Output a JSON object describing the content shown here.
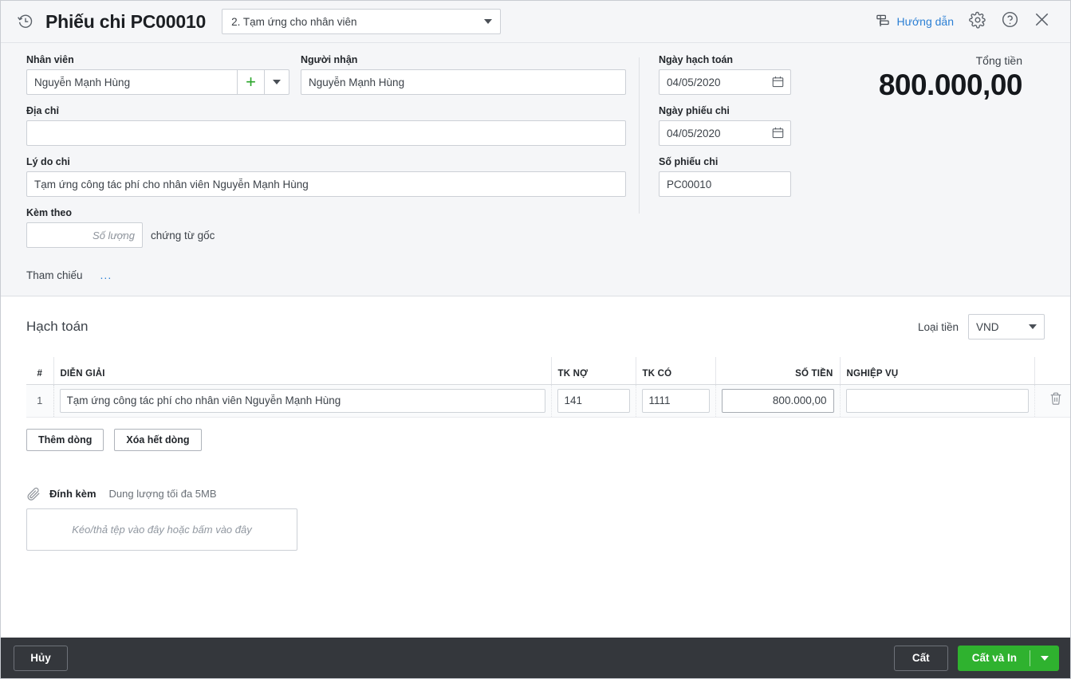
{
  "header": {
    "history_icon": "history-clock-icon",
    "title": "Phiếu chi PC00010",
    "type_value": "2. Tạm ứng cho nhân viên",
    "guide_label": "Hướng dẫn",
    "guide_icon": "signpost-icon",
    "settings_icon": "gear-icon",
    "help_icon": "question-circle-icon",
    "close_icon": "close-icon"
  },
  "form": {
    "employee_label": "Nhân viên",
    "employee_value": "Nguyễn Mạnh Hùng",
    "employee_add_icon": "plus-icon",
    "employee_dropdown_icon": "chevron-down-icon",
    "receiver_label": "Người nhận",
    "receiver_value": "Nguyễn Mạnh Hùng",
    "address_label": "Địa chỉ",
    "address_value": "",
    "reason_label": "Lý do chi",
    "reason_value": "Tạm ứng công tác phí cho nhân viên Nguyễn Mạnh Hùng",
    "attached_label": "Kèm theo",
    "attached_qty_placeholder": "Số lượng",
    "attached_qty_value": "",
    "attached_suffix": "chứng từ gốc",
    "reference_label": "Tham chiếu",
    "reference_dots": "...",
    "posting_date_label": "Ngày hạch toán",
    "posting_date_value": "04/05/2020",
    "voucher_date_label": "Ngày phiếu chi",
    "voucher_date_value": "04/05/2020",
    "voucher_no_label": "Số phiếu chi",
    "voucher_no_value": "PC00010",
    "calendar_icon": "calendar-icon",
    "total_label": "Tổng tiền",
    "total_value": "800.000,00"
  },
  "accounting": {
    "section_title": "Hạch toán",
    "currency_label": "Loại tiền",
    "currency_value": "VND",
    "currency_icon": "chevron-down-icon",
    "columns": {
      "index": "#",
      "description": "DIỄN GIẢI",
      "debit": "TK NỢ",
      "credit": "TK CÓ",
      "amount": "SỐ TIỀN",
      "operation": "NGHIỆP VỤ"
    },
    "rows": [
      {
        "index": "1",
        "description": "Tạm ứng công tác phí cho nhân viên Nguyễn Mạnh Hùng",
        "debit": "141",
        "credit": "1111",
        "amount": "800.000,00",
        "operation": "",
        "delete_icon": "trash-icon"
      }
    ],
    "add_row_label": "Thêm dòng",
    "clear_rows_label": "Xóa hết dòng"
  },
  "attachment": {
    "clip_icon": "paperclip-icon",
    "title": "Đính kèm",
    "subtitle": "Dung lượng tối đa 5MB",
    "dropzone_text": "Kéo/thả tệp vào đây hoặc bấm vào đây"
  },
  "footer": {
    "cancel_label": "Hủy",
    "save_label": "Cất",
    "save_print_label": "Cất và In",
    "save_print_caret_icon": "chevron-down-icon"
  },
  "colors": {
    "accent_green": "#2fb22f",
    "link_blue": "#2b7fd4",
    "panel_bg": "#f5f6f8",
    "footer_bg": "#34373c"
  }
}
